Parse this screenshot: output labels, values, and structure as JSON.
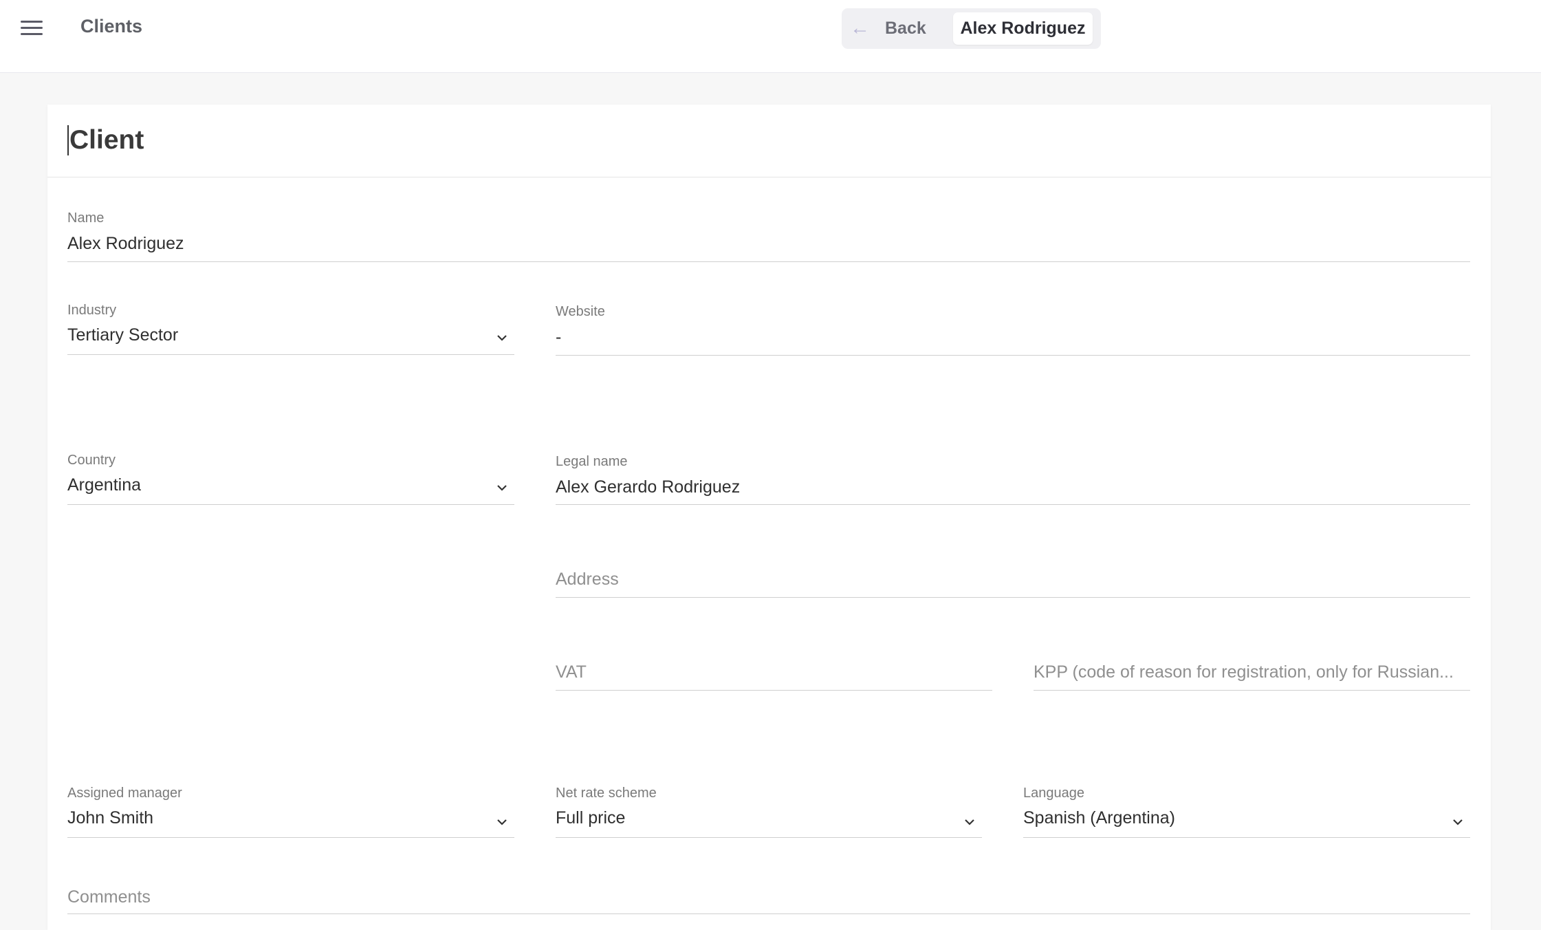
{
  "header": {
    "app_title": "Clients",
    "back_label": "Back",
    "current_crumb": "Alex Rodriguez"
  },
  "card": {
    "title": "Client"
  },
  "fields": {
    "name": {
      "label": "Name",
      "value": "Alex Rodriguez"
    },
    "industry": {
      "label": "Industry",
      "value": "Tertiary Sector"
    },
    "website": {
      "label": "Website",
      "value": "-"
    },
    "country": {
      "label": "Country",
      "value": "Argentina"
    },
    "legal_name": {
      "label": "Legal name",
      "value": "Alex Gerardo Rodriguez"
    },
    "address": {
      "placeholder": "Address"
    },
    "vat": {
      "placeholder": "VAT"
    },
    "kpp": {
      "placeholder": "KPP (code of reason for registration, only for Russian..."
    },
    "assigned_manager": {
      "label": "Assigned manager",
      "value": "John Smith"
    },
    "net_rate_scheme": {
      "label": "Net rate scheme",
      "value": "Full price"
    },
    "language": {
      "label": "Language",
      "value": "Spanish (Argentina)"
    },
    "comments": {
      "placeholder": "Comments"
    }
  },
  "icons": {
    "menu": "menu-icon",
    "back": "arrow-left-icon",
    "dropdown": "chevron-down-icon"
  }
}
